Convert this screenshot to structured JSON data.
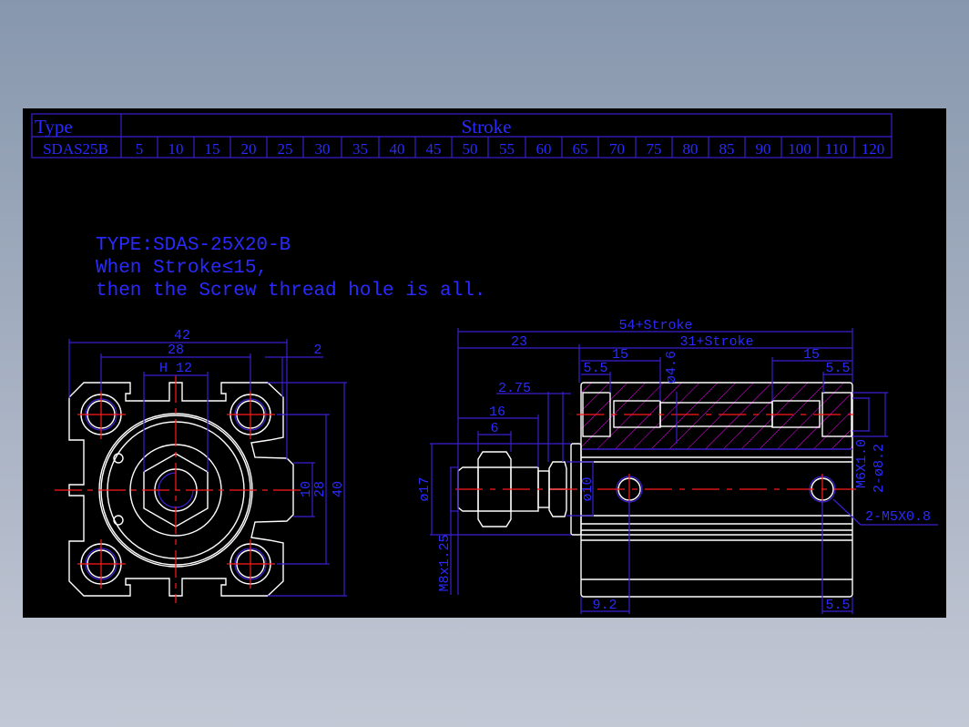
{
  "table": {
    "type_header": "Type",
    "stroke_header": "Stroke",
    "model": "SDAS25B",
    "strokes": [
      "5",
      "10",
      "15",
      "20",
      "25",
      "30",
      "35",
      "40",
      "45",
      "50",
      "55",
      "60",
      "65",
      "70",
      "75",
      "80",
      "85",
      "90",
      "100",
      "110",
      "120"
    ]
  },
  "notes": {
    "line1": "TYPE:SDAS-25X20-B",
    "line2": "When Stroke≤15,",
    "line3": "then the Screw thread hole is all."
  },
  "front_view": {
    "dim_42": "42",
    "dim_28_top": "28",
    "dim_h12": "H 12",
    "dim_2": "2",
    "dim_10": "10",
    "dim_28_side": "28",
    "dim_40": "40"
  },
  "side_view": {
    "dim_total": "54+Stroke",
    "dim_23": "23",
    "dim_body": "31+Stroke",
    "dim_15_left": "15",
    "dim_15_right": "15",
    "dim_55_left": "5.5",
    "dim_55_right": "5.5",
    "dim_d46": "ø4.6",
    "dim_275": "2.75",
    "dim_16": "16",
    "dim_6": "6",
    "dim_d17": "ø17",
    "dim_m8": "M8x1.25",
    "dim_d10": "ø10",
    "dim_m6": "M6X1.0",
    "dim_d82": "2-ø8.2",
    "dim_m5": "2-M5X0.8",
    "dim_92": "9.2",
    "dim_55_bottom": "5.5"
  },
  "colors": {
    "background": "#000000",
    "dimension": "#2a2aff",
    "outline": "#ffffff",
    "centerline": "#ff1a1a",
    "hatch": "#ff00ff"
  }
}
